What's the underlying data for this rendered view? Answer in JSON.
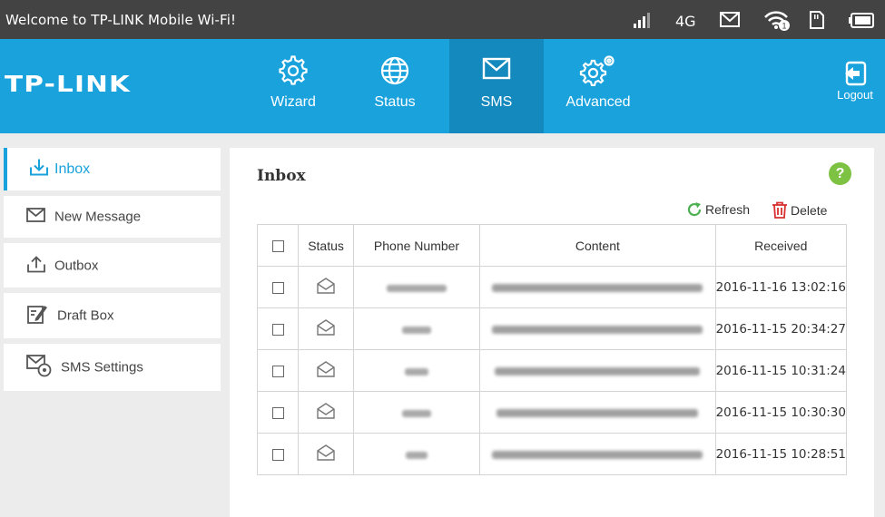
{
  "statusbar": {
    "welcome": "Welcome to TP-LINK Mobile Wi-Fi!",
    "network": "4G",
    "wifi_clients": "1",
    "icons": [
      "signal-icon",
      "mail-icon",
      "wifi-icon",
      "sim-card-icon",
      "battery-icon"
    ]
  },
  "header": {
    "logo": "TP-LINK",
    "nav": [
      {
        "label": "Wizard",
        "icon": "gear-icon"
      },
      {
        "label": "Status",
        "icon": "globe-icon"
      },
      {
        "label": "SMS",
        "icon": "envelope-icon",
        "active": true
      },
      {
        "label": "Advanced",
        "icon": "gears-icon"
      }
    ],
    "logout": "Logout"
  },
  "sidebar": {
    "items": [
      {
        "label": "Inbox",
        "icon": "inbox-download-icon",
        "active": true
      },
      {
        "label": "New Message",
        "icon": "envelope-icon"
      },
      {
        "label": "Outbox",
        "icon": "outbox-upload-icon"
      },
      {
        "label": "Draft Box",
        "icon": "draft-edit-icon"
      },
      {
        "label": "SMS Settings",
        "icon": "sms-settings-icon"
      }
    ]
  },
  "main": {
    "title": "Inbox",
    "help": "?",
    "refresh": "Refresh",
    "delete": "Delete",
    "columns": [
      "",
      "Status",
      "Phone Number",
      "Content",
      "Received"
    ],
    "rows": [
      {
        "received": "2016-11-16 13:02:16"
      },
      {
        "received": "2016-11-15 20:34:27"
      },
      {
        "received": "2016-11-15 10:31:24"
      },
      {
        "received": "2016-11-15 10:30:30"
      },
      {
        "received": "2016-11-15 10:28:51"
      }
    ]
  },
  "colors": {
    "topbar": "#434343",
    "brand_blue": "#1aa2dd",
    "active_nav": "#1489bd",
    "help_green": "#7dc242",
    "delete_red": "#d9302f",
    "refresh_green": "#4caf50"
  }
}
